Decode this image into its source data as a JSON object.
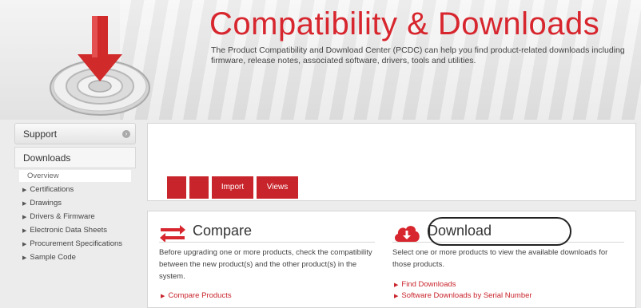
{
  "banner": {
    "title": "Compatibility & Downloads",
    "subtitle": "The Product Compatibility and Download Center (PCDC) can help you find product-related downloads including firmware, release notes, associated software, drivers, tools and utilities."
  },
  "sidebar": {
    "support_label": "Support",
    "downloads_label": "Downloads",
    "overview_label": "Overview",
    "items": [
      {
        "label": "Certifications"
      },
      {
        "label": "Drawings"
      },
      {
        "label": "Drivers & Firmware"
      },
      {
        "label": "Electronic Data Sheets"
      },
      {
        "label": "Procurement Specifications"
      },
      {
        "label": "Sample Code"
      }
    ]
  },
  "tabs": [
    {
      "label": ""
    },
    {
      "label": ""
    },
    {
      "label": "Import"
    },
    {
      "label": "Views"
    }
  ],
  "compare": {
    "heading": "Compare",
    "description": "Before upgrading one or more products, check the compatibility between the new product(s) and the other product(s) in the system.",
    "links": [
      {
        "label": "Compare Products"
      }
    ]
  },
  "download": {
    "heading": "Download",
    "description": "Select one or more products to view the available downloads for those products.",
    "links": [
      {
        "label": "Find Downloads"
      },
      {
        "label": "Software Downloads by Serial Number"
      }
    ]
  },
  "colors": {
    "brand_red": "#d7262e",
    "tab_red": "#c8242b"
  }
}
